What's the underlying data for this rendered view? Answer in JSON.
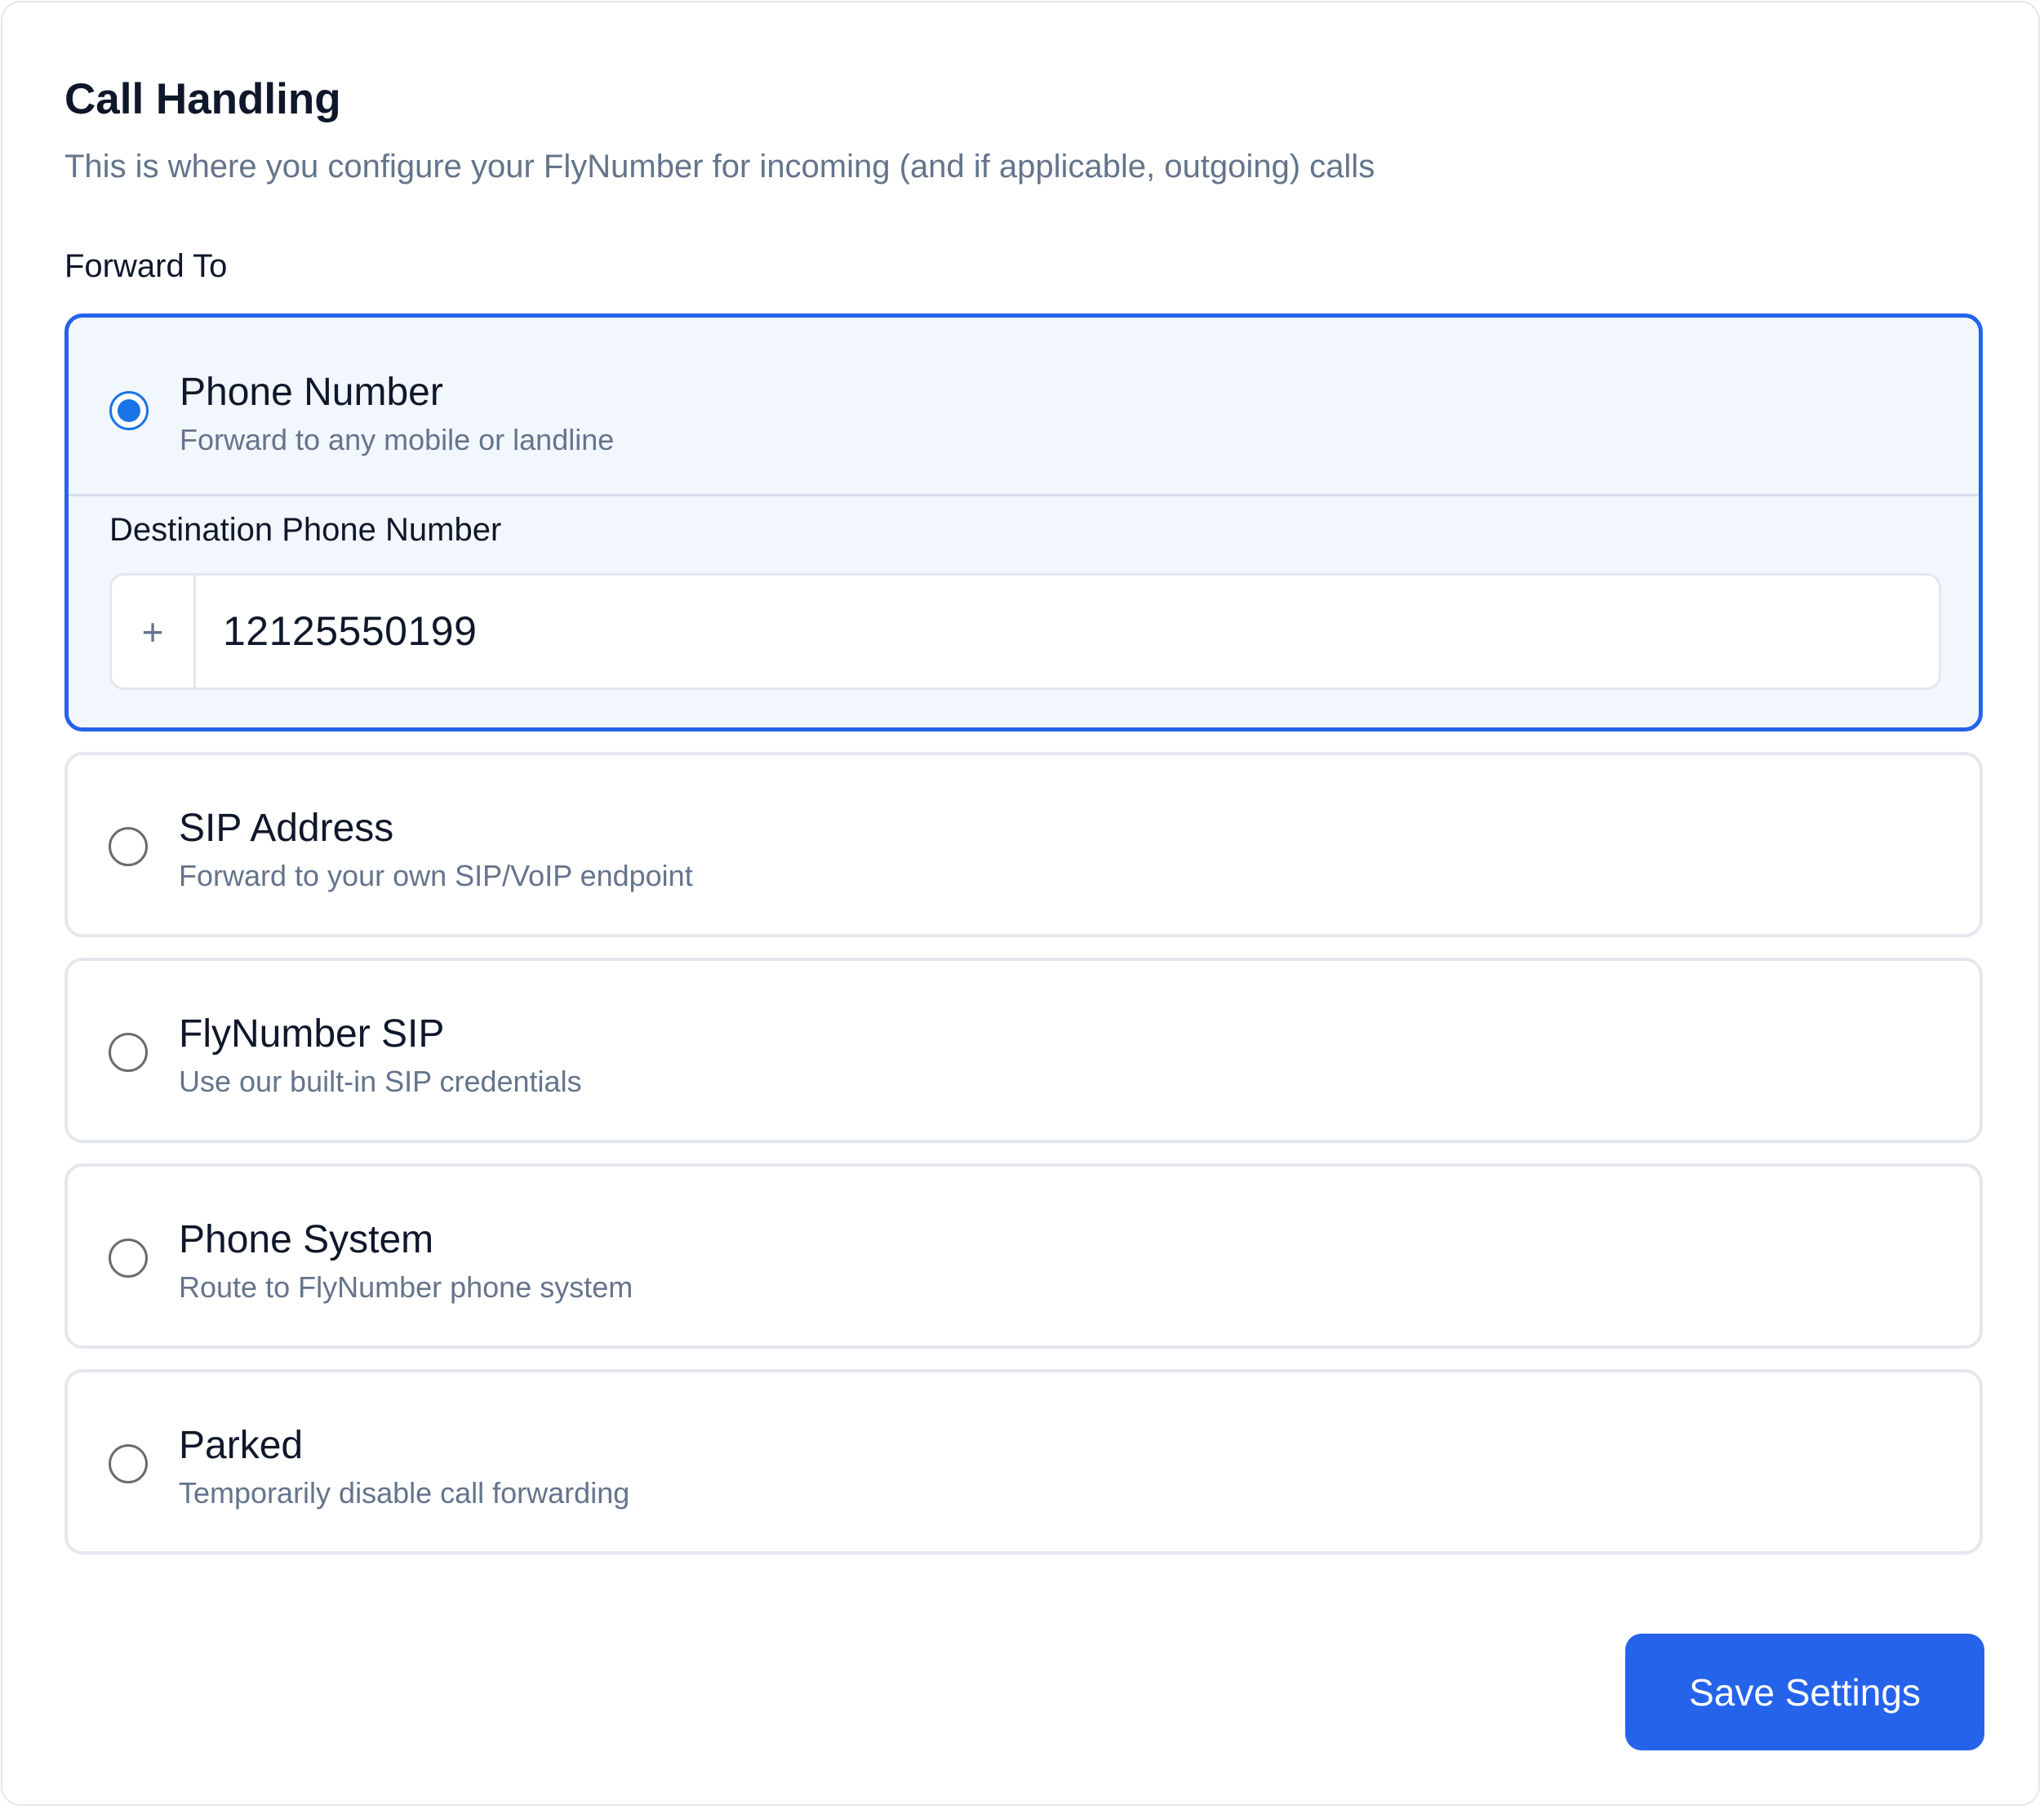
{
  "header": {
    "title": "Call Handling",
    "subtitle": "This is where you configure your FlyNumber for incoming (and if applicable, outgoing) calls"
  },
  "forward_to": {
    "label": "Forward To",
    "selected": "phone-number",
    "options": [
      {
        "id": "phone-number",
        "title": "Phone Number",
        "description": "Forward to any mobile or landline",
        "checked": true
      },
      {
        "id": "sip-address",
        "title": "SIP Address",
        "description": "Forward to your own SIP/VoIP endpoint",
        "checked": false
      },
      {
        "id": "flynumber-sip",
        "title": "FlyNumber SIP",
        "description": "Use our built-in SIP credentials",
        "checked": false
      },
      {
        "id": "phone-system",
        "title": "Phone System",
        "description": "Route to FlyNumber phone system",
        "checked": false
      },
      {
        "id": "parked",
        "title": "Parked",
        "description": "Temporarily disable call forwarding",
        "checked": false
      }
    ]
  },
  "destination": {
    "label": "Destination Phone Number",
    "prefix": "+",
    "value": "12125550199"
  },
  "actions": {
    "save_label": "Save Settings"
  },
  "colors": {
    "accent": "#2563eb",
    "radio_checked": "#1a73e8",
    "selected_bg": "#f2f6fd",
    "muted_text": "#64748b",
    "border": "#e3e7ee"
  }
}
